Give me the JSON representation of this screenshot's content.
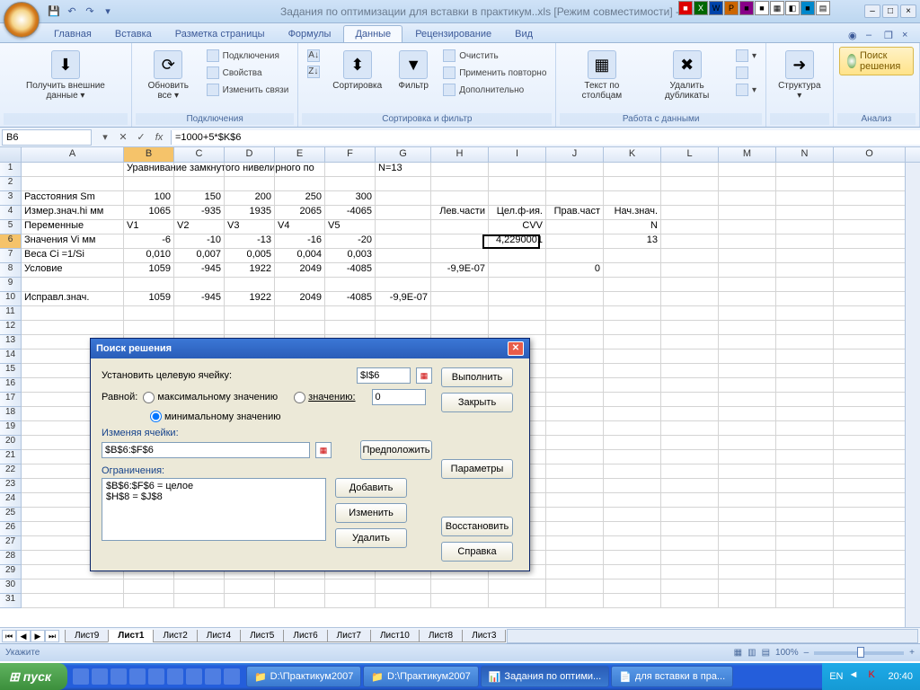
{
  "title": "Задания по оптимизации для вставки в практикум..xls [Режим совместимости] - Mic",
  "tabs": [
    "Главная",
    "Вставка",
    "Разметка страницы",
    "Формулы",
    "Данные",
    "Рецензирование",
    "Вид"
  ],
  "active_tab": 4,
  "ribbon": {
    "g1": {
      "btn": "Получить\nвнешние данные ▾",
      "label": ""
    },
    "g2": {
      "btn": "Обновить\nвсе ▾",
      "items": [
        "Подключения",
        "Свойства",
        "Изменить связи"
      ],
      "label": "Подключения"
    },
    "g3": {
      "sort": "Сортировка",
      "filter": "Фильтр",
      "extra": [
        "Очистить",
        "Применить повторно",
        "Дополнительно"
      ],
      "label": "Сортировка и фильтр"
    },
    "g4": {
      "btn1": "Текст по\nстолбцам",
      "btn2": "Удалить\nдубликаты",
      "label": "Работа с данными"
    },
    "g5": {
      "btn": "Структура\n▾",
      "label": ""
    },
    "g6": {
      "solver": "Поиск решения",
      "label": "Анализ"
    }
  },
  "name_box": "B6",
  "formula": "=1000+5*$K$6",
  "cols": {
    "A": 114,
    "B": 56,
    "C": 56,
    "D": 56,
    "E": 56,
    "F": 56,
    "G": 62,
    "H": 64,
    "I": 64,
    "J": 64,
    "K": 64,
    "L": 64,
    "M": 64,
    "N": 64,
    "O": 64
  },
  "grid": {
    "r1": {
      "B": "Уравнивание замкнутого нивелирного по",
      "G": "N=13"
    },
    "r3": {
      "A": "Расстояния Sm",
      "B": "100",
      "C": "150",
      "D": "200",
      "E": "250",
      "F": "300"
    },
    "r4": {
      "A": "Измер.знач.hi мм",
      "B": "1065",
      "C": "-935",
      "D": "1935",
      "E": "2065",
      "F": "-4065",
      "H": "Лев.части",
      "I": "Цел.ф-ия.",
      "J": "Прав.част",
      "K": "Нач.знач."
    },
    "r5": {
      "A": "Переменные",
      "B": "V1",
      "C": "V2",
      "D": "V3",
      "E": "V4",
      "F": "V5",
      "I": "CVV",
      "K": "N"
    },
    "r6": {
      "A": "Значения Vi мм",
      "B": "-6",
      "C": "-10",
      "D": "-13",
      "E": "-16",
      "F": "-20",
      "I": "4,2290001",
      "K": "13"
    },
    "r7": {
      "A": "Веса Ci =1/Si",
      "B": "0,010",
      "C": "0,007",
      "D": "0,005",
      "E": "0,004",
      "F": "0,003"
    },
    "r8": {
      "A": "Условие",
      "B": "1059",
      "C": "-945",
      "D": "1922",
      "E": "2049",
      "F": "-4085",
      "H": "-9,9E-07",
      "J": "0"
    },
    "r10": {
      "A": "Исправл.знач.",
      "B": "1059",
      "C": "-945",
      "D": "1922",
      "E": "2049",
      "F": "-4085",
      "G": "-9,9E-07"
    }
  },
  "sheets": [
    "Лист9",
    "Лист1",
    "Лист2",
    "Лист4",
    "Лист5",
    "Лист6",
    "Лист7",
    "Лист10",
    "Лист8",
    "Лист3"
  ],
  "active_sheet": 1,
  "status": "Укажите",
  "zoom": "100%",
  "dialog": {
    "title": "Поиск решения",
    "target_label": "Установить целевую ячейку:",
    "target": "$I$6",
    "equal": "Равной:",
    "opt_max": "максимальному значению",
    "opt_val": "значению:",
    "opt_min": "минимальному значению",
    "val": "0",
    "changing_label": "Изменяя ячейки:",
    "changing": "$B$6:$F$6",
    "guess": "Предположить",
    "constraints_label": "Ограничения:",
    "constraints": [
      "$B$6:$F$6 = целое",
      "$H$8 = $J$8"
    ],
    "btns": {
      "run": "Выполнить",
      "close": "Закрыть",
      "params": "Параметры",
      "add": "Добавить",
      "edit": "Изменить",
      "del": "Удалить",
      "reset": "Восстановить",
      "help": "Справка"
    }
  },
  "taskbar": {
    "start": "пуск",
    "tasks": [
      {
        "label": "D:\\Практикум2007"
      },
      {
        "label": "D:\\Практикум2007"
      },
      {
        "label": "Задания по оптими...",
        "active": true
      },
      {
        "label": "для вставки в пра..."
      }
    ],
    "lang": "EN",
    "time": "20:40"
  }
}
